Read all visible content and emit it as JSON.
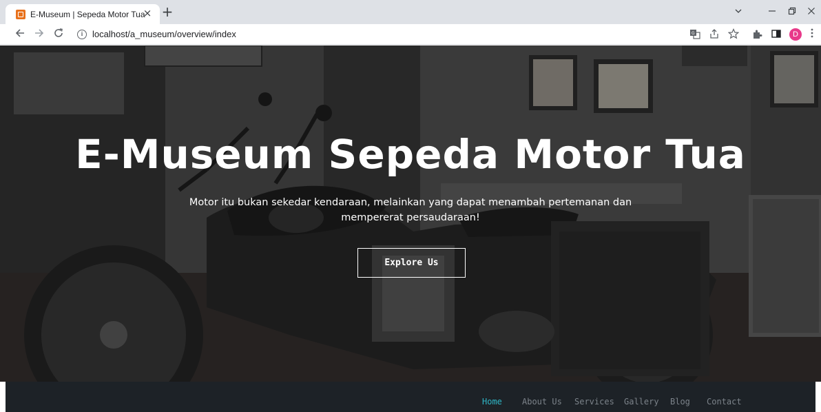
{
  "browser": {
    "tab_title": "E-Museum | Sepeda Motor Tua",
    "tab_close": "×",
    "new_tab": "+",
    "url": "localhost/a_museum/overview/index",
    "profile_initial": "D",
    "icons": [
      "back-icon",
      "forward-icon",
      "reload-icon",
      "info-icon",
      "translate-icon",
      "share-icon",
      "bookmark-star-icon",
      "extensions-icon",
      "sidebar-icon",
      "more-menu-icon",
      "minimize-icon",
      "restore-icon",
      "close-window-icon",
      "tab-dropdown-icon"
    ]
  },
  "hero": {
    "title": "E-Museum Sepeda Motor Tua",
    "subtitle": "Motor itu bukan sekedar kendaraan, melainkan yang dapat menambah pertemanan dan mempererat persaudaraan!",
    "button_label": "Explore Us"
  },
  "nav": {
    "items": [
      {
        "label": "Home",
        "active": true
      },
      {
        "label": "About Us",
        "active": false
      },
      {
        "label": "Services",
        "active": false
      },
      {
        "label": "Gallery",
        "active": false
      },
      {
        "label": "Blog",
        "active": false
      },
      {
        "label": "Contact",
        "active": false
      }
    ]
  },
  "colors": {
    "nav_background": "#1d2227",
    "nav_active": "#2fb6c6",
    "nav_inactive": "#7c838a",
    "tab_strip": "#dee1e6",
    "profile": "#e8398a"
  }
}
